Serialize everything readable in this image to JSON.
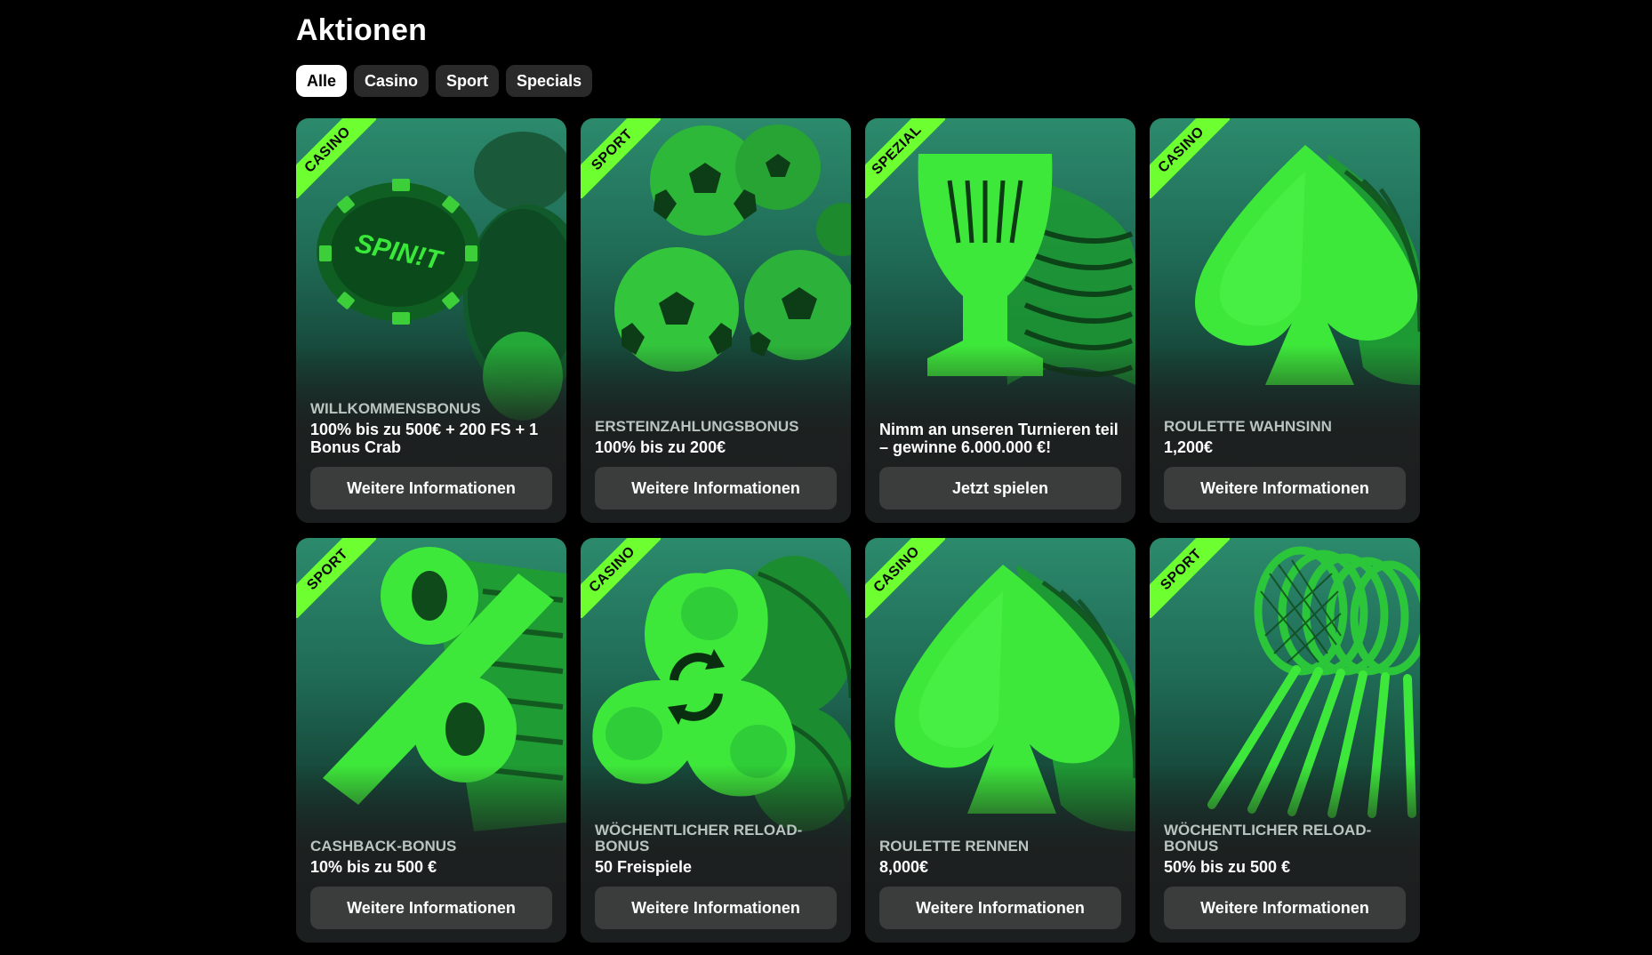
{
  "page": {
    "title": "Aktionen"
  },
  "filters": [
    {
      "label": "Alle",
      "active": true
    },
    {
      "label": "Casino",
      "active": false
    },
    {
      "label": "Sport",
      "active": false
    },
    {
      "label": "Specials",
      "active": false
    }
  ],
  "colors": {
    "background": "#000000",
    "ribbon": "#6dff2f",
    "accent_green": "#39e83a",
    "card_bottom": "#1c1f1f",
    "button": "#3a3d3c"
  },
  "cards": [
    {
      "ribbon": "CASINO",
      "label": "WILLKOMMENSBONUS",
      "value": "100% bis zu 500€ + 200 FS + 1 Bonus Crab",
      "button": "Weitere Informationen",
      "art": "casino-chips-icon",
      "chip_text": "SPIN!T"
    },
    {
      "ribbon": "SPORT",
      "label": "ERSTEINZAHLUNGSBONUS",
      "value": "100% bis zu 200€",
      "button": "Weitere Informationen",
      "art": "soccer-balls-icon"
    },
    {
      "ribbon": "SPEZIAL",
      "label": "",
      "value": "Nimm an unseren Turnieren teil – gewinne 6.000.000 €!",
      "button": "Jetzt spielen",
      "art": "trophy-icon"
    },
    {
      "ribbon": "CASINO",
      "label": "ROULETTE WAHNSINN",
      "value": "1,200€",
      "button": "Weitere Informationen",
      "art": "spade-icon"
    },
    {
      "ribbon": "SPORT",
      "label": "CASHBACK-BONUS",
      "value": "10% bis zu 500 €",
      "button": "Weitere Informationen",
      "art": "percent-icon"
    },
    {
      "ribbon": "CASINO",
      "label": "WÖCHENTLICHER RELOAD-BONUS",
      "value": "50 Freispiele",
      "button": "Weitere Informationen",
      "art": "fidget-spinner-icon"
    },
    {
      "ribbon": "CASINO",
      "label": "ROULETTE RENNEN",
      "value": "8,000€",
      "button": "Weitere Informationen",
      "art": "spade-icon"
    },
    {
      "ribbon": "SPORT",
      "label": "WÖCHENTLICHER RELOAD-BONUS",
      "value": "50% bis zu 500 €",
      "button": "Weitere Informationen",
      "art": "tennis-racket-icon"
    }
  ]
}
